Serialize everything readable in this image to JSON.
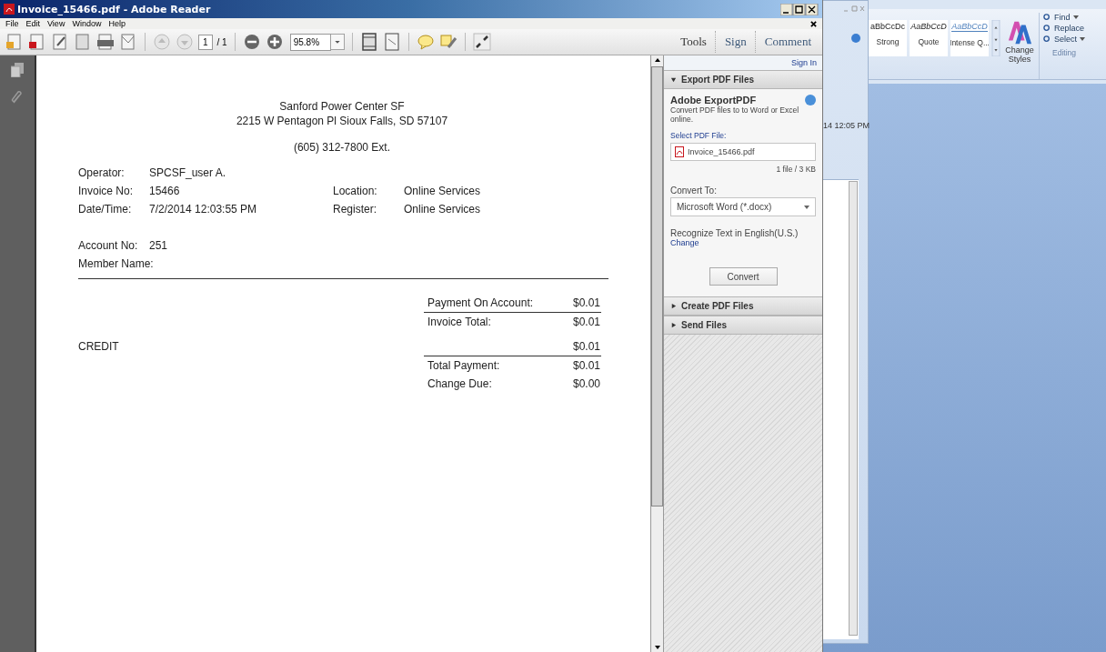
{
  "window": {
    "title": "Invoice_15466.pdf - Adobe Reader"
  },
  "menu": [
    {
      "label": "File"
    },
    {
      "label": "Edit"
    },
    {
      "label": "View"
    },
    {
      "label": "Window"
    },
    {
      "label": "Help"
    }
  ],
  "toolbar": {
    "page_number": "1",
    "page_total": "/ 1",
    "zoom": "95.8%"
  },
  "tabs": [
    {
      "label": "Tools"
    },
    {
      "label": "Sign"
    },
    {
      "label": "Comment"
    }
  ],
  "document": {
    "header": [
      "Sanford Power Center SF",
      "2215 W Pentagon Pl Sioux Falls, SD 57107"
    ],
    "phone": "(605) 312-7800 Ext.",
    "fields": [
      {
        "label": "Operator:",
        "value": "SPCSF_user A."
      },
      {
        "label": "Invoice No:",
        "value": "15466",
        "label_2": "Location:",
        "value_2": "Online Services"
      },
      {
        "label": "Date/Time:",
        "value": "7/2/2014 12:03:55 PM",
        "label_2": "Register:",
        "value_2": "Online Services"
      }
    ],
    "account": [
      {
        "label": "Account No:",
        "value": "251"
      },
      {
        "label": "Member Name:"
      }
    ],
    "summary": [
      {
        "kind": "total",
        "label": "Payment On Account:",
        "amount": "$0.01",
        "divider_above": false
      },
      {
        "kind": "total",
        "label": "Invoice Total:",
        "amount": "$0.01",
        "divider_above": true
      },
      {
        "kind": "tender",
        "label": "CREDIT",
        "amount": "$0.01",
        "divider_above": false
      },
      {
        "kind": "total",
        "label": "Total Payment:",
        "amount": "$0.01",
        "divider_above": true
      },
      {
        "kind": "total",
        "label": "Change Due:",
        "amount": "$0.00",
        "divider_above": false
      }
    ]
  },
  "right_pane": {
    "sign_in": "Sign In",
    "sections": [
      {
        "title": "Export PDF Files",
        "expanded": true
      },
      {
        "title": "Create PDF Files",
        "expanded": false
      },
      {
        "title": "Send Files",
        "expanded": false
      }
    ],
    "export": {
      "heading": "Adobe ExportPDF",
      "description": "Convert PDF files to to Word or Excel online.",
      "select_label": "Select PDF File:",
      "file_name": "Invoice_15466.pdf",
      "file_info": "1 file / 3 KB",
      "convert_to_label": "Convert To:",
      "convert_to_value": "Microsoft Word (*.docx)",
      "recognize": "Recognize Text in English(U.S.)",
      "change_link": "Change",
      "convert_button": "Convert"
    }
  },
  "background_window": {
    "timestamp": "14 12:05 PM"
  },
  "word_ribbon": {
    "styles": [
      {
        "preview": "aBbCcDc",
        "name": "Strong"
      },
      {
        "preview": "AaBbCcD",
        "name": "Quote"
      },
      {
        "preview": "AaBbCcD",
        "name": "Intense Q..."
      }
    ],
    "change_styles": [
      "Change",
      "Styles"
    ],
    "editing": [
      {
        "label": "Find",
        "dropdown": true
      },
      {
        "label": "Replace",
        "dropdown": false
      },
      {
        "label": "Select",
        "dropdown": true
      }
    ],
    "editing_group": "Editing"
  }
}
